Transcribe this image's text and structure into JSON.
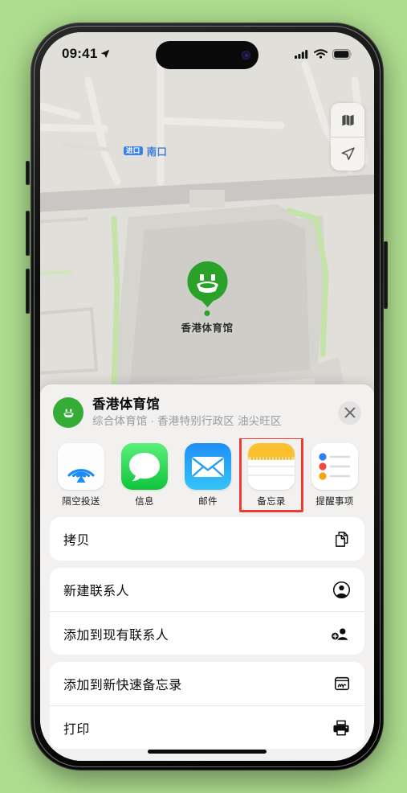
{
  "theme": {
    "page_background": "#aedd8f",
    "accent_green": "#34ac36",
    "highlight_red": "#ef3b2d",
    "map_background": "#e0ded8",
    "sheet_background": "#f2f1ef"
  },
  "status_bar": {
    "time": "09:41",
    "location_icon": "location-arrow-icon",
    "signal_icon": "cellular-signal-icon",
    "wifi_icon": "wifi-icon",
    "battery_icon": "battery-full-icon"
  },
  "map": {
    "label": {
      "badge": "进口",
      "text": "南口"
    },
    "pin": {
      "icon": "stadium-icon",
      "label": "香港体育馆"
    },
    "controls": [
      {
        "name": "map-layers-button",
        "icon": "map-layers-icon"
      },
      {
        "name": "locate-me-button",
        "icon": "location-arrow-icon"
      }
    ]
  },
  "share_sheet": {
    "place": {
      "icon": "stadium-icon",
      "title": "香港体育馆",
      "subtitle": "综合体育馆 · 香港特别行政区 油尖旺区"
    },
    "close_label": "关闭",
    "apps": [
      {
        "id": "airdrop",
        "label": "隔空投送",
        "icon": "airdrop-icon",
        "highlighted": false
      },
      {
        "id": "messages",
        "label": "信息",
        "icon": "messages-icon",
        "highlighted": false
      },
      {
        "id": "mail",
        "label": "邮件",
        "icon": "mail-icon",
        "highlighted": false
      },
      {
        "id": "notes",
        "label": "备忘录",
        "icon": "notes-icon",
        "highlighted": true
      },
      {
        "id": "reminders",
        "label": "提醒事项",
        "icon": "reminders-icon",
        "highlighted": false
      }
    ],
    "action_groups": [
      {
        "rows": [
          {
            "label": "拷贝",
            "icon": "copy-doc-icon"
          }
        ]
      },
      {
        "rows": [
          {
            "label": "新建联系人",
            "icon": "person-circle-icon"
          },
          {
            "label": "添加到现有联系人",
            "icon": "person-badge-plus-icon"
          }
        ]
      },
      {
        "rows": [
          {
            "label": "添加到新快速备忘录",
            "icon": "quick-note-icon"
          },
          {
            "label": "打印",
            "icon": "printer-icon"
          }
        ]
      }
    ]
  }
}
